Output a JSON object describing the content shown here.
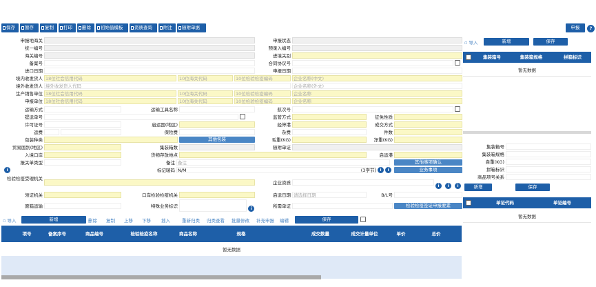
{
  "toolbar": {
    "buttons": [
      "保存",
      "暂存",
      "复制",
      "打印",
      "删除",
      "初始值模板",
      "资质查询",
      "附注",
      "随附单据"
    ],
    "declare": "申报",
    "help": "?"
  },
  "form": {
    "r1": {
      "l1": "申报地海关",
      "l2": "申报状态"
    },
    "r2": {
      "l1": "统一编号",
      "l2": "预录入编号"
    },
    "r3": {
      "l1": "海关编号",
      "l2": "进境关别"
    },
    "r4": {
      "l1": "备案号",
      "l2": "合同协议号"
    },
    "r5": {
      "l1": "进口日期",
      "l2": "申报日期"
    },
    "r6": {
      "l1": "境内收发货人",
      "p1": "18位社会信用代码",
      "p2": "10位海关代码",
      "p3": "10位检验检疫编码",
      "p4": "企业名称(中文)"
    },
    "r7": {
      "l1": "境外收发货人",
      "p1": "境外收发货人代码",
      "p4": "企业名称(外文)"
    },
    "r8": {
      "l1": "生产销售单位",
      "p1": "18位社会信用代码",
      "p2": "10位海关代码",
      "p3": "10位检验检疫编码",
      "p4": "企业名称"
    },
    "r9": {
      "l1": "申报单位",
      "p1": "18位社会信用代码",
      "p2": "10位海关代码",
      "p3": "10位检验检疫编码",
      "p4": "企业名称"
    },
    "r10": {
      "l1": "运输方式",
      "l2": "运输工具名称",
      "l3": "航次号"
    },
    "r11": {
      "l1": "提运单号",
      "l2": "监管方式",
      "l3": "征免性质"
    },
    "r12": {
      "l1": "许可证号",
      "l2": "启运国(地区)",
      "l3": "经停港",
      "l4": "成交方式"
    },
    "r13": {
      "l1": "运费",
      "l2": "保险费",
      "l3": "杂费",
      "l4": "件数"
    },
    "r14": {
      "l1": "包装种类",
      "btn": "其他包装",
      "l3": "毛重(KG)",
      "l4": "净重(KG)"
    },
    "r15": {
      "l1": "贸易国别(地区)",
      "l2": "集装箱数",
      "l3": "随附单证"
    },
    "r16": {
      "l1": "入境口岸",
      "l2": "货物存放地点",
      "l3": "启运港"
    },
    "r17": {
      "l1": "报关单类型",
      "l2": "备注",
      "p2": "备注",
      "btn": "其他事项确认"
    },
    "r18": {
      "l2": "标记唛码",
      "v2": "N/M",
      "bytes": "(3字节)",
      "btn": "业务事项"
    },
    "r19": {
      "l1": "检验检疫受理机关",
      "l2": "企业资质"
    },
    "r20": {
      "l1": "领证机关",
      "l2": "口岸检验检疫机关",
      "l3": "启运日期",
      "p3": "请选择日期",
      "l4": "B/L号"
    },
    "r21": {
      "l1": "原箱运输",
      "l2": "特殊业务标识",
      "l3": "所需单证",
      "btn": "检验检疫签证申报要素"
    }
  },
  "container": {
    "import": "导入",
    "add": "新增",
    "save": "保存",
    "cols": [
      "集装箱号",
      "集装箱规格",
      "拼箱标识"
    ],
    "empty": "暂无数据"
  },
  "container_detail": {
    "labels": [
      "集装箱号",
      "集装箱规格",
      "自重(KG)",
      "拼箱标识",
      "商品项号关系"
    ]
  },
  "cert": {
    "add": "新增",
    "save": "保存",
    "cols": [
      "单证代码",
      "单证编号"
    ],
    "empty": "暂无数据"
  },
  "goods": {
    "import": "导入",
    "add": "新增",
    "actions": [
      "删除",
      "复制",
      "上移",
      "下移",
      "插入",
      "重新归类",
      "归类查看",
      "批量修改",
      "补充申报",
      "编辑"
    ],
    "save": "保存",
    "cols": [
      "项号",
      "备案序号",
      "商品编号",
      "检验检疫名称",
      "商品名称",
      "规格",
      "成交数量",
      "成交计量单位",
      "单价",
      "总价"
    ],
    "empty": "暂无数据"
  }
}
